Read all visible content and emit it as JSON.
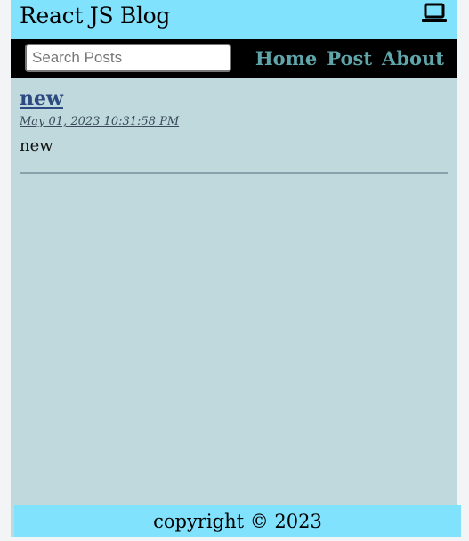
{
  "header": {
    "title": "React JS Blog",
    "icon": "laptop-icon"
  },
  "nav": {
    "search": {
      "placeholder": "Search Posts",
      "value": ""
    },
    "links": [
      "Home",
      "Post",
      "About"
    ]
  },
  "posts": [
    {
      "title": "new",
      "datetime": "May 01, 2023 10:31:58 PM",
      "body": "new"
    }
  ],
  "footer": {
    "text": "copyright © 2023"
  },
  "colors": {
    "header_bg": "#80e2fc",
    "nav_bg": "#000000",
    "nav_link": "#5fa5a9",
    "main_bg": "#bfd9dc",
    "post_title": "#2d4a82"
  }
}
